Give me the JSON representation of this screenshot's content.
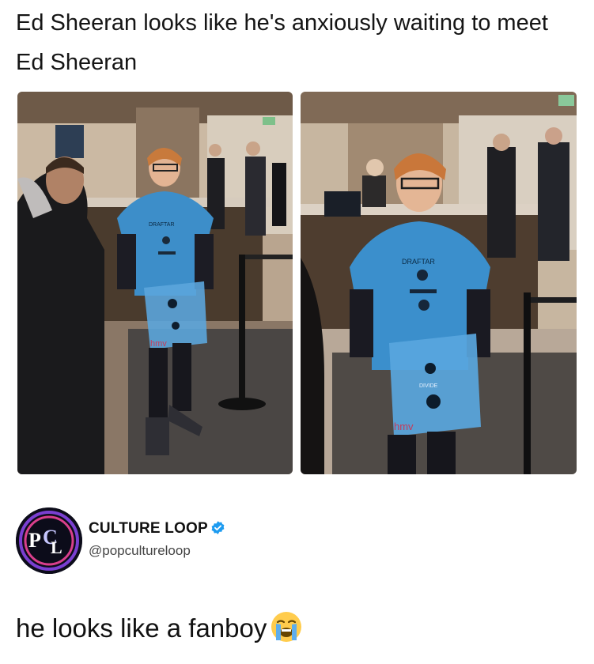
{
  "post": {
    "caption": "Ed Sheeran looks like he's anxiously waiting to meet Ed Sheeran"
  },
  "images": {
    "left_bag_text": "hmv",
    "right_bag_text": "hmv",
    "left_tshirt_text": "DRAFTAR",
    "right_tshirt_text": "DRAFTAR",
    "right_bag_print": "DIVIDE"
  },
  "account": {
    "name": "CULTURE LOOP",
    "handle": "@popcultureloop",
    "avatar_icon": "pop-culture-loop-logo",
    "verified_icon": "verified-badge-icon",
    "verified_color": "#1d9bf0"
  },
  "tweet": {
    "text": "he looks like a fanboy",
    "emoji": "loudly-crying-face-emoji"
  }
}
